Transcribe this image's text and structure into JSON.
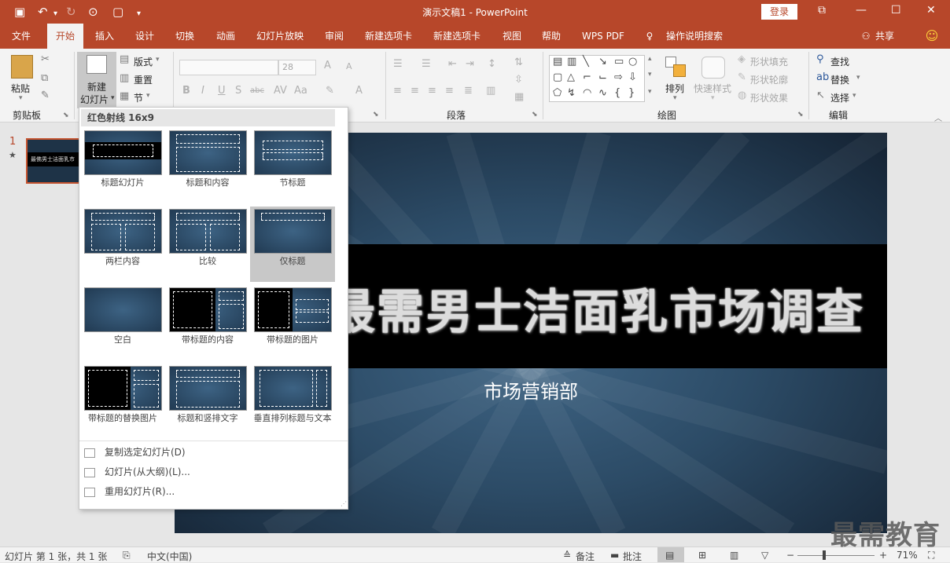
{
  "titlebar": {
    "doc_title": "演示文稿1  -  PowerPoint",
    "login_label": "登录",
    "save_icon": "save-icon",
    "undo_icon": "undo-icon",
    "redo_icon": "redo-icon"
  },
  "tabs": [
    "文件",
    "开始",
    "插入",
    "设计",
    "切换",
    "动画",
    "幻灯片放映",
    "审阅",
    "新建选项卡",
    "新建选项卡",
    "视图",
    "帮助",
    "WPS PDF",
    "操作说明搜索"
  ],
  "active_tab": "开始",
  "share_label": "共享",
  "ribbon": {
    "paste_label": "粘贴",
    "new_slide_label_1": "新建",
    "new_slide_label_2": "幻灯片",
    "layout_label": "版式",
    "reset_label": "重置",
    "section_label": "节",
    "font_size": "28",
    "arrange_label": "排列",
    "quick_style_label": "快速样式",
    "shape_fill_label": "形状填充",
    "shape_outline_label": "形状轮廓",
    "shape_effect_label": "形状效果",
    "find_label": "查找",
    "replace_label": "替换",
    "select_label": "选择",
    "groups": {
      "clipboard": "剪贴板",
      "paragraph": "段落",
      "drawing": "绘图",
      "editing": "编辑"
    }
  },
  "dropdown": {
    "header": "红色射线 16x9",
    "layouts": [
      "标题幻灯片",
      "标题和内容",
      "节标题",
      "两栏内容",
      "比较",
      "仅标题",
      "空白",
      "带标题的内容",
      "带标题的图片",
      "带标题的替换图片",
      "标题和竖排文字",
      "垂直排列标题与文本"
    ],
    "selected": "仅标题",
    "actions": [
      "复制选定幻灯片(D)",
      "幻灯片(从大纲)(L)...",
      "重用幻灯片(R)..."
    ]
  },
  "thumbnail": {
    "number": "1",
    "star": "★",
    "caption": "最佛男士洁面乳市"
  },
  "slide": {
    "title": "最需男士洁面乳市场调查",
    "subtitle": "市场营销部"
  },
  "statusbar": {
    "slide_info": "幻灯片 第 1 张，共 1 张",
    "language": "中文(中国)",
    "notes_label": "备注",
    "comments_label": "批注",
    "zoom": "71%"
  },
  "watermark": "最需教育"
}
